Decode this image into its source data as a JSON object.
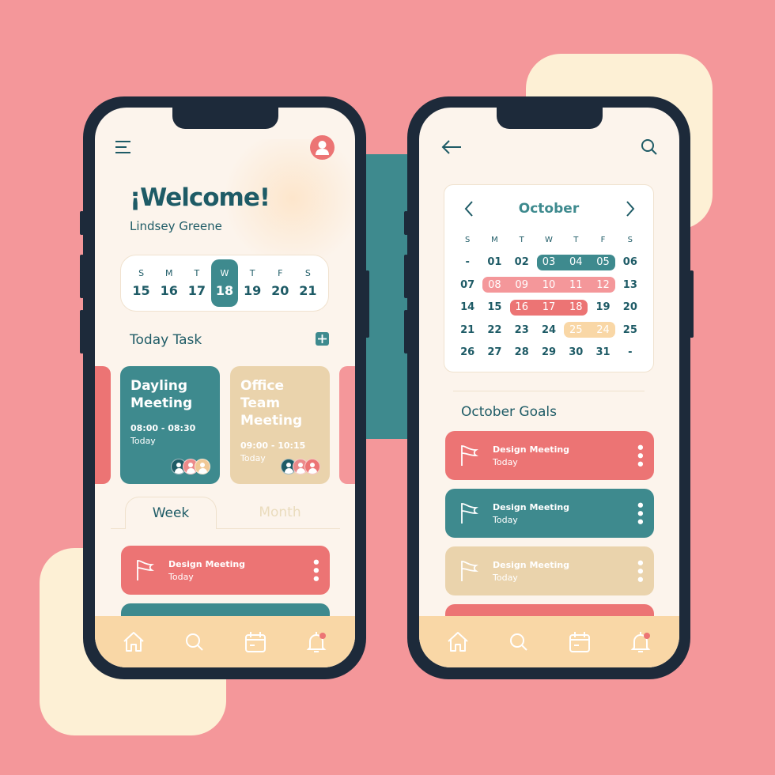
{
  "colors": {
    "background": "#f4979a",
    "teal": "#3e8a8e",
    "coral": "#ec7474",
    "beige": "#ead3ac",
    "peach": "#f9d7a6",
    "cream": "#fcf4ec",
    "dark_text": "#1e5b66"
  },
  "home": {
    "menu_icon": "hamburger-icon",
    "avatar_icon": "user-icon",
    "welcome": "¡Welcome!",
    "user_name": "Lindsey Greene",
    "week": [
      {
        "l": "S",
        "n": "15"
      },
      {
        "l": "M",
        "n": "16"
      },
      {
        "l": "T",
        "n": "17"
      },
      {
        "l": "W",
        "n": "18",
        "selected": true
      },
      {
        "l": "T",
        "n": "19"
      },
      {
        "l": "F",
        "n": "20"
      },
      {
        "l": "S",
        "n": "21"
      }
    ],
    "today_task": "Today Task",
    "tasks": [
      {
        "title": "Dayling Meeting",
        "time": "08:00 - 08:30",
        "day": "Today"
      },
      {
        "title": "Office Team Meeting",
        "time": "09:00 - 10:15",
        "day": "Today"
      }
    ],
    "tabs": {
      "week": "Week",
      "month": "Month",
      "active": "Week"
    },
    "items": [
      {
        "title": "Design Meeting",
        "sub": "Today"
      }
    ]
  },
  "calendar": {
    "back_icon": "arrow-left-icon",
    "search_icon": "search-icon",
    "month": "October",
    "weekdays": [
      "S",
      "M",
      "T",
      "W",
      "T",
      "F",
      "S"
    ],
    "rows": [
      [
        "-",
        "01",
        "02",
        "03",
        "04",
        "05",
        "06"
      ],
      [
        "07",
        "08",
        "09",
        "10",
        "11",
        "12",
        "13"
      ],
      [
        "14",
        "15",
        "16",
        "17",
        "18",
        "19",
        "20"
      ],
      [
        "21",
        "22",
        "23",
        "24",
        "25",
        "24",
        "25"
      ],
      [
        "26",
        "27",
        "28",
        "29",
        "30",
        "31",
        "-"
      ]
    ],
    "goals_title": "October Goals",
    "goals": [
      {
        "title": "Design Meeting",
        "sub": "Today"
      },
      {
        "title": "Design Meeting",
        "sub": "Today"
      },
      {
        "title": "Design Meeting",
        "sub": "Today"
      }
    ]
  },
  "nav": [
    "home-icon",
    "search-icon",
    "calendar-icon",
    "bell-icon"
  ]
}
